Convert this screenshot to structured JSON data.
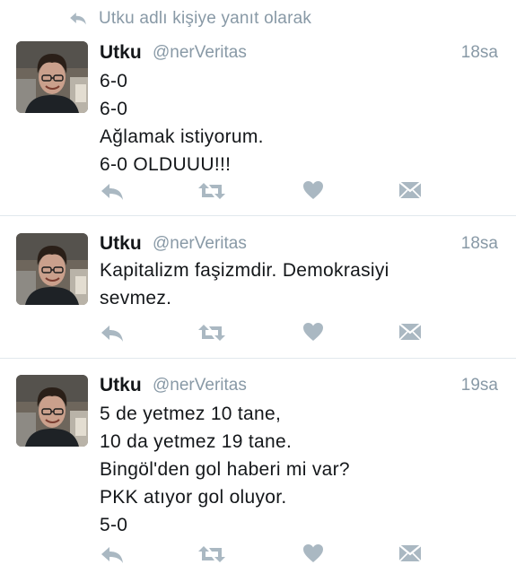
{
  "reply_context": {
    "text": "Utku adlı kişiye yanıt olarak",
    "icon": "reply-icon"
  },
  "colors": {
    "secondary_text": "#8899a6",
    "action_icon": "#aab8c2",
    "divider": "#e1e8ed"
  },
  "tweets": [
    {
      "name": "Utku",
      "handle": "@nerVeritas",
      "time": "18sa",
      "lines": [
        "6-0",
        "6-0",
        "Ağlamak istiyorum.",
        "6-0 OLDUUU!!!"
      ]
    },
    {
      "name": "Utku",
      "handle": "@nerVeritas",
      "time": "18sa",
      "lines": [
        "Kapitalizm faşizmdir. Demokrasiyi",
        "sevmez."
      ]
    },
    {
      "name": "Utku",
      "handle": "@nerVeritas",
      "time": "19sa",
      "lines": [
        "5 de yetmez 10 tane,",
        "10 da yetmez 19 tane.",
        "Bingöl'den gol haberi mi var?",
        "PKK atıyor gol oluyor.",
        "5-0"
      ]
    }
  ],
  "action_icons": [
    "reply-icon",
    "retweet-icon",
    "like-heart-icon",
    "direct-message-icon"
  ]
}
